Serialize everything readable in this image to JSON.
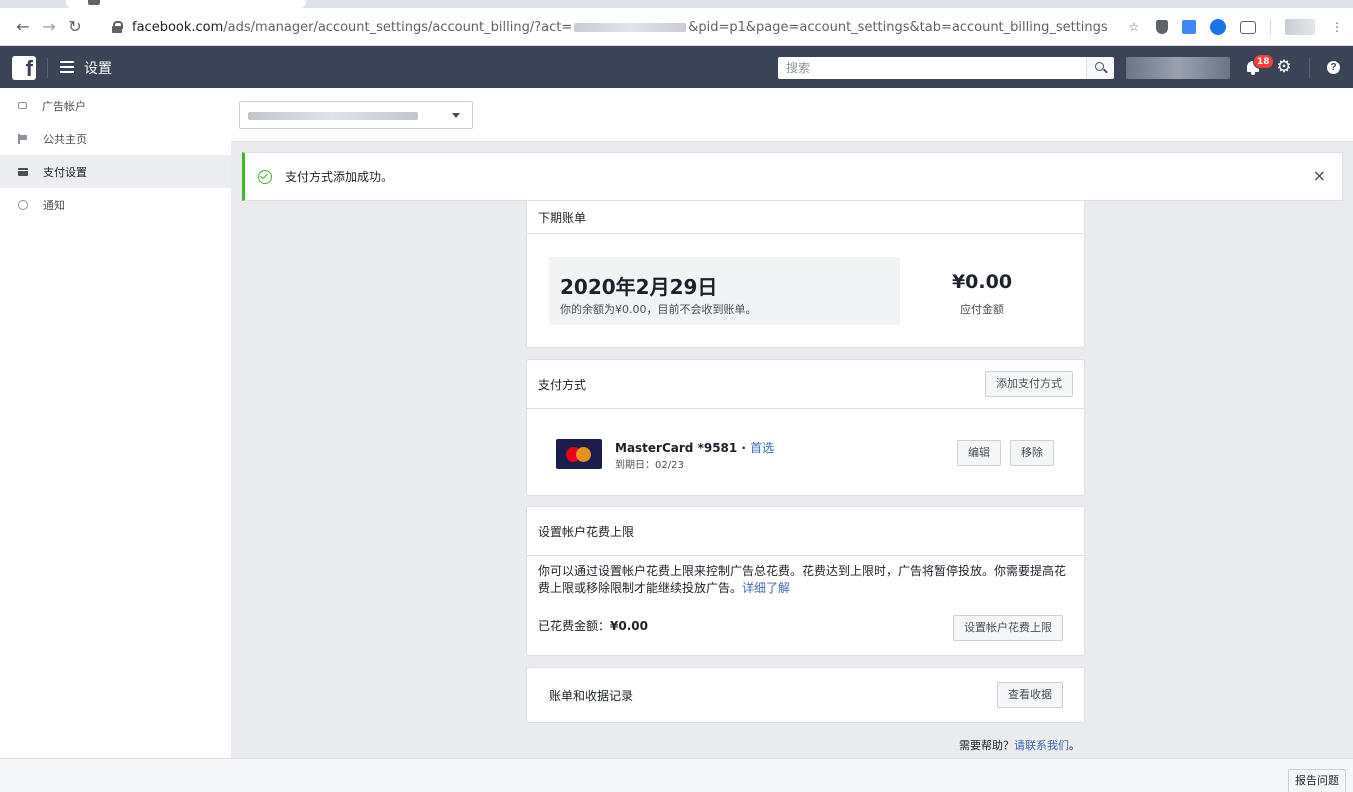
{
  "browser": {
    "url_host": "facebook.com",
    "url_path": "/ads/manager/account_settings/account_billing/?act=",
    "url_query": "&pid=p1&page=account_settings&tab=account_billing_settings"
  },
  "topbar": {
    "title": "设置",
    "search_placeholder": "搜索",
    "notification_count": "18"
  },
  "sidebar": {
    "items": [
      {
        "label": "广告帐户",
        "icon": "ad-account-icon"
      },
      {
        "label": "公共主页",
        "icon": "flag-icon"
      },
      {
        "label": "支付设置",
        "icon": "credit-card-icon",
        "active": true
      },
      {
        "label": "通知",
        "icon": "globe-icon"
      }
    ]
  },
  "toast": {
    "message": "支付方式添加成功。",
    "close": "×"
  },
  "next_bill": {
    "title": "下期账单",
    "date": "2020年2月29日",
    "note": "你的余额为¥0.00，目前不会收到账单。",
    "amount": "¥0.00",
    "amount_label": "应付金额"
  },
  "payment_methods": {
    "title": "支付方式",
    "add_button": "添加支付方式",
    "card_name": "MasterCard *9581 · ",
    "card_primary": "首选",
    "card_expiry": "到期日：02/23",
    "edit_button": "编辑",
    "remove_button": "移除"
  },
  "spending_limit": {
    "title": "设置帐户花费上限",
    "description": "你可以通过设置帐户花费上限来控制广告总花费。花费达到上限时，广告将暂停投放。你需要提高花费上限或移除限制才能继续投放广告。",
    "learn_more": "详细了解",
    "spent_label": "已花费金额：",
    "spent_value": "¥0.00",
    "button": "设置帐户花费上限"
  },
  "records": {
    "title": "账单和收据记录",
    "button": "查看收据"
  },
  "help": {
    "question": "需要帮助？",
    "link": "请联系我们",
    "suffix": "。"
  },
  "footer": {
    "report_button": "报告问题"
  }
}
